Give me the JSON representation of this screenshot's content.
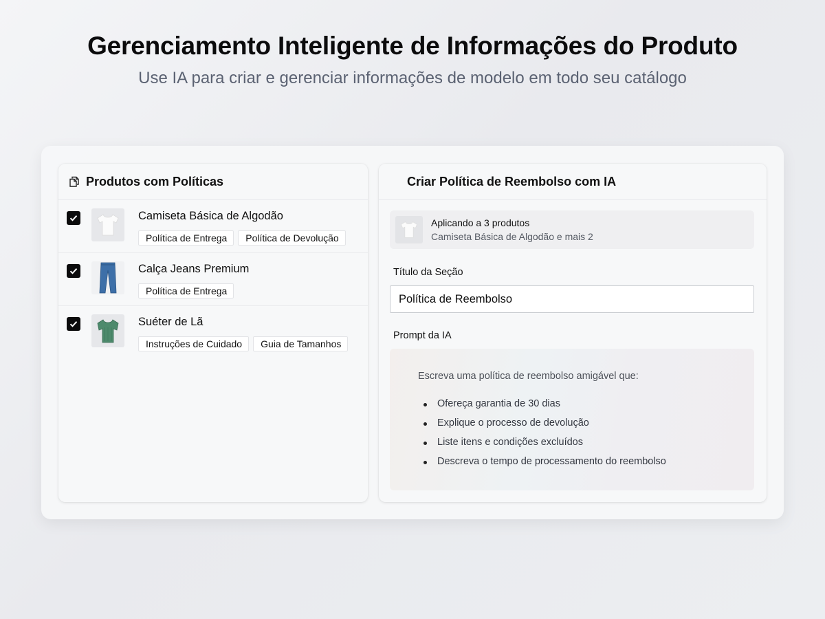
{
  "hero": {
    "title": "Gerenciamento Inteligente de Informações do Produto",
    "subtitle": "Use IA para criar e gerenciar informações de modelo em todo seu catálogo"
  },
  "left_panel": {
    "header": "Produtos com Políticas",
    "header_icon": "copy-icon",
    "products": [
      {
        "name": "Camiseta Básica de Algodão",
        "thumb_icon": "tshirt-icon",
        "checked": true,
        "tags": [
          "Política de Entrega",
          "Política de Devolução"
        ]
      },
      {
        "name": "Calça Jeans Premium",
        "thumb_icon": "jeans-icon",
        "checked": true,
        "tags": [
          "Política de Entrega"
        ]
      },
      {
        "name": "Suéter de Lã",
        "thumb_icon": "sweater-icon",
        "checked": true,
        "tags": [
          "Instruções de Cuidado",
          "Guia de Tamanhos"
        ]
      }
    ]
  },
  "right_panel": {
    "header": "Criar Política de Reembolso com IA",
    "apply": {
      "title": "Aplicando a 3 produtos",
      "subtitle": "Camiseta Básica de Algodão e mais 2"
    },
    "section_title_label": "Título da Seção",
    "section_title_value": "Política de Reembolso",
    "prompt_label": "Prompt da IA",
    "prompt": {
      "intro": "Escreva uma política de reembolso amigável que:",
      "items": [
        "Ofereça garantia de 30 dias",
        "Explique o processo de devolução",
        "Liste itens e condições excluídos",
        "Descreva o tempo de processamento do reembolso"
      ]
    }
  },
  "colors": {
    "checkbox": "#0b0b0c",
    "subtitle_text": "#5b6272",
    "jeans": "#3d6fa8",
    "sweater": "#4d8a6c"
  }
}
